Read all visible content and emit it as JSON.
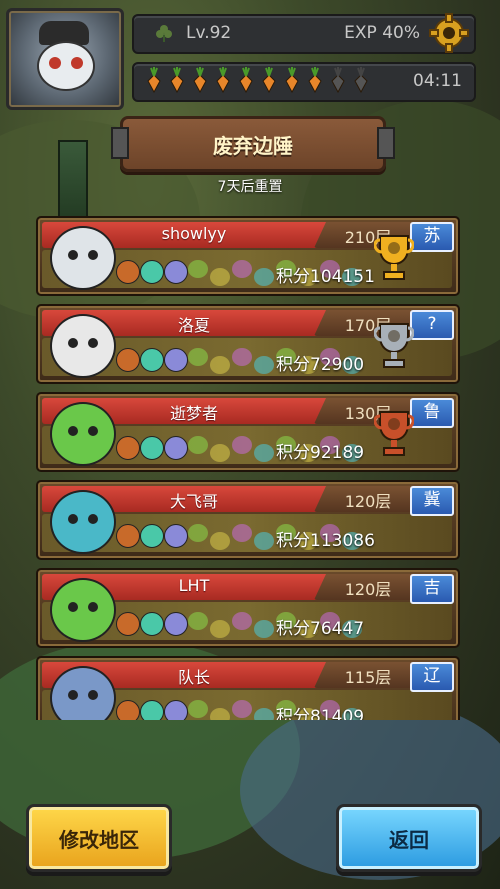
{
  "header": {
    "level": "Lv.92",
    "exp": "EXP 40%",
    "timer": "04:11",
    "stamina_total": 10,
    "stamina_filled": 8,
    "icons": [
      "clover-icon",
      "gear-icon",
      "carrot-icon",
      "avatar-portrait"
    ]
  },
  "banner": {
    "title": "废弃边陲",
    "reset_note": "7天后重置"
  },
  "score_label": "积分",
  "leaderboard": [
    {
      "name": "showlyy",
      "floor": "210层",
      "region": "苏",
      "score": "104151",
      "trophy": "gold"
    },
    {
      "name": "洛夏",
      "floor": "170层",
      "region": "?",
      "score": "72900",
      "trophy": "silver"
    },
    {
      "name": "逝梦者",
      "floor": "130层",
      "region": "鲁",
      "score": "92189",
      "trophy": "bronze"
    },
    {
      "name": "大飞哥",
      "floor": "120层",
      "region": "冀",
      "score": "113086",
      "trophy": ""
    },
    {
      "name": "LHT",
      "floor": "120层",
      "region": "吉",
      "score": "76447",
      "trophy": ""
    },
    {
      "name": "队长",
      "floor": "115层",
      "region": "辽",
      "score": "81409",
      "trophy": ""
    }
  ],
  "buttons": {
    "edit_region": "修改地区",
    "back": "返回"
  },
  "colors": {
    "name_bar": "#d8483c",
    "region_badge": "#2a5ab0",
    "edit_button": "#e8a21c",
    "back_button": "#2a9ae0",
    "gold": "#f0b020",
    "silver": "#a8b0b8",
    "bronze": "#c8502a"
  }
}
